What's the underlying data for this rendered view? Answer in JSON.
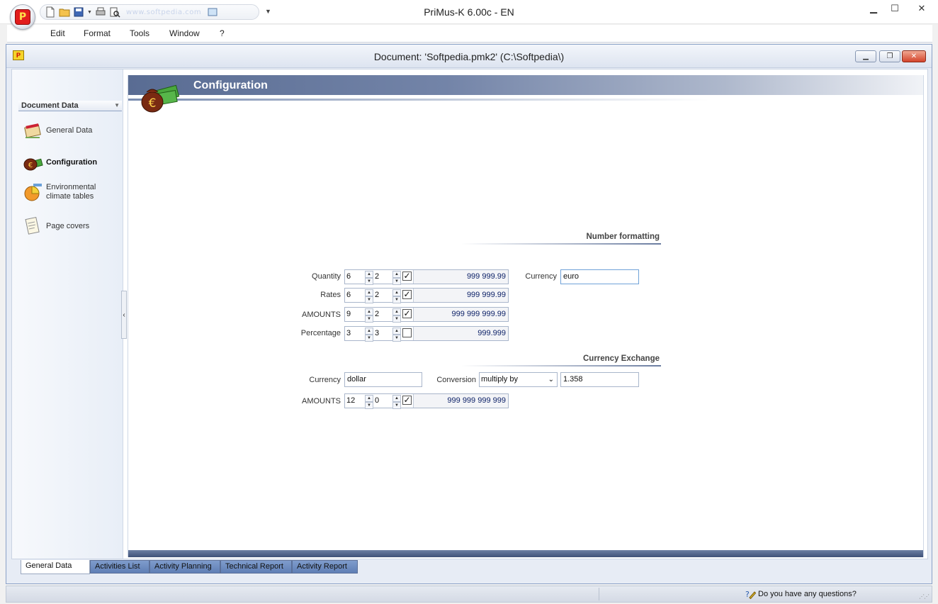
{
  "app": {
    "title": "PriMus-K    6.00c - EN",
    "qat_text": "www.softpedia.com",
    "orb_letter": "P"
  },
  "menu": {
    "items": [
      "Edit",
      "Format",
      "Tools",
      "Window",
      "?"
    ]
  },
  "document": {
    "title": "Document: 'Softpedia.pmk2'   (C:\\Softpedia\\)",
    "icon_letter": "P"
  },
  "sidebar": {
    "header": "Document Data",
    "items": [
      {
        "label": "General Data",
        "icon": "book-icon"
      },
      {
        "label": "Configuration",
        "icon": "money-bag-icon",
        "active": true
      },
      {
        "label": "Environmental climate tables",
        "icon": "pie-chart-icon"
      },
      {
        "label": "Page covers",
        "icon": "page-icon"
      }
    ],
    "collapse_glyph": "‹"
  },
  "panel": {
    "title": "Configuration"
  },
  "number_formatting": {
    "title": "Number formatting",
    "rows": [
      {
        "label": "Quantity",
        "digits": "6",
        "decimals": "2",
        "checked": true,
        "preview": "999 999.99"
      },
      {
        "label": "Rates",
        "digits": "6",
        "decimals": "2",
        "checked": true,
        "preview": "999 999.99"
      },
      {
        "label": "AMOUNTS",
        "digits": "9",
        "decimals": "2",
        "checked": true,
        "preview": "999 999 999.99"
      },
      {
        "label": "Percentage",
        "digits": "3",
        "decimals": "3",
        "checked": false,
        "preview": "999.999"
      }
    ],
    "currency_label": "Currency",
    "currency_value": "euro"
  },
  "currency_exchange": {
    "title": "Currency Exchange",
    "currency_label": "Currency",
    "currency_value": "dollar",
    "conversion_label": "Conversion",
    "conversion_value": "multiply by",
    "rate_value": "1.358",
    "amounts": {
      "label": "AMOUNTS",
      "digits": "12",
      "decimals": "0",
      "checked": true,
      "preview": "999 999 999 999"
    }
  },
  "tabs": [
    "General Data",
    "Activities List",
    "Activity Planning",
    "Technical Report",
    "Activity Report"
  ],
  "status": {
    "help_text": "Do you have any questions?"
  },
  "colors": {
    "banner": "#596c93",
    "tab_blue": "#6d8dc2",
    "preview_text": "#0a1f66"
  }
}
